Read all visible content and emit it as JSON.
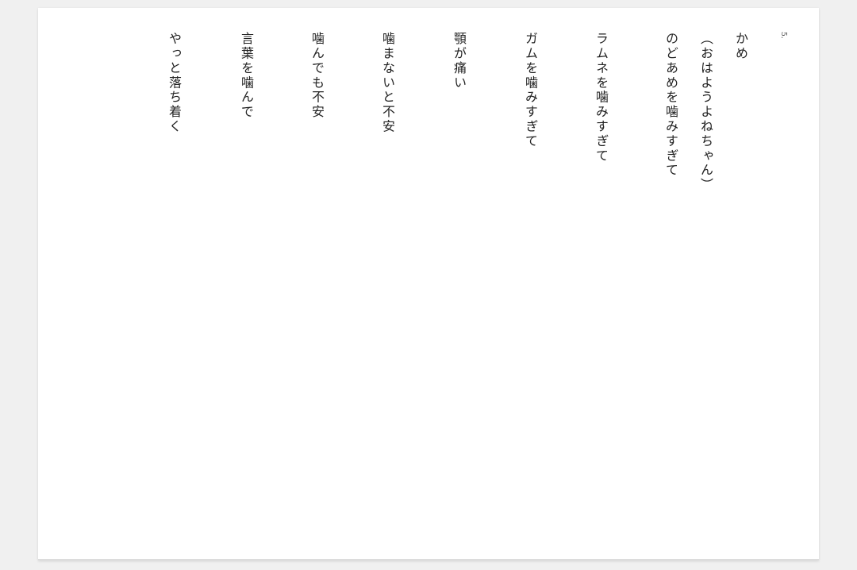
{
  "page": {
    "page_number": "5.",
    "lines": [
      "かめ",
      "（おはようよねちゃん）",
      "のどあめを噛みすぎて",
      "ラムネを噛みすぎて",
      "ガムを噛みすぎて",
      "顎が痛い",
      "噛まないと不安",
      "噛んでも不安",
      "言葉を噛んで",
      "やっと落ち着く"
    ]
  }
}
